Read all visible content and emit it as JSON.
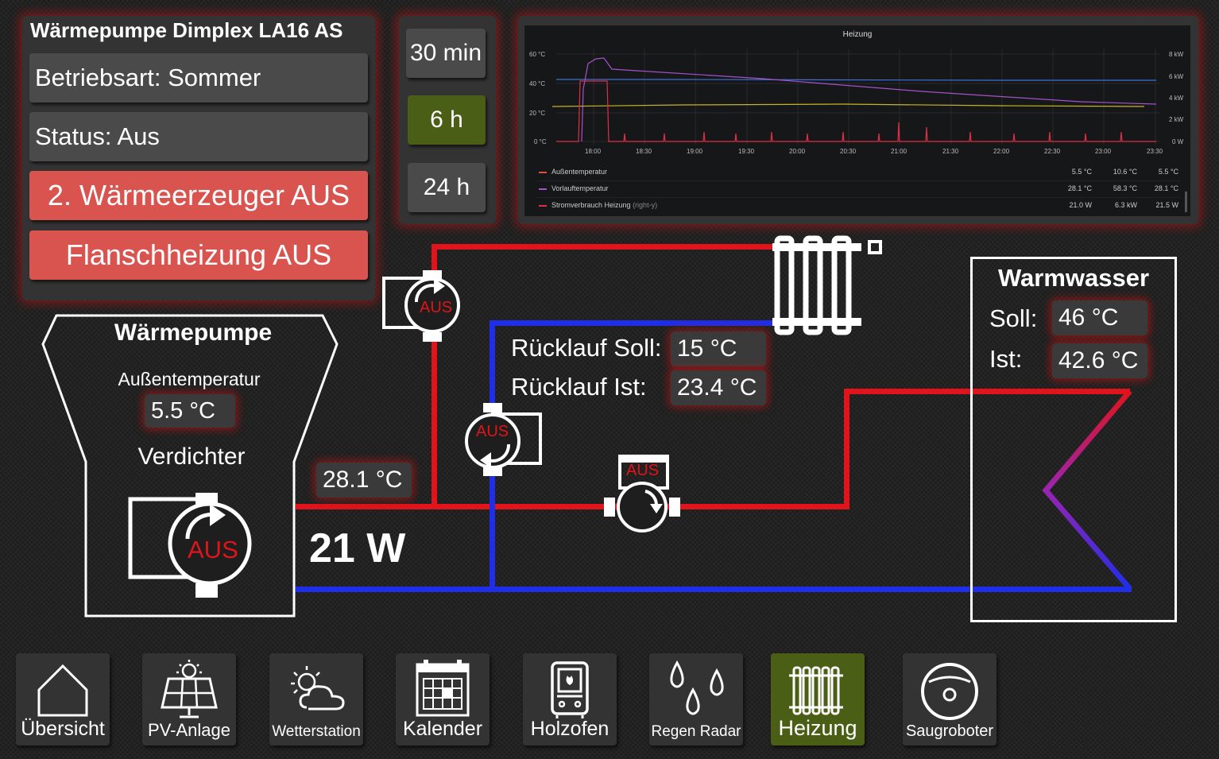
{
  "status_panel": {
    "title": "Wärmepumpe Dimplex LA16 AS",
    "mode": "Betriebsart: Sommer",
    "status": "Status: Aus",
    "second_generator": "2. Wärmeerzeuger AUS",
    "flange_heater": "Flanschheizung AUS"
  },
  "time_buttons": [
    "30 min",
    "6 h",
    "24 h"
  ],
  "graph": {
    "title": "Heizung",
    "y_left_ticks": [
      "60 °C",
      "40 °C",
      "20 °C",
      "0 °C"
    ],
    "y_right_ticks": [
      "8 kW",
      "6 kW",
      "4 kW",
      "2 kW",
      "0 W"
    ],
    "x_ticks": [
      "18:00",
      "18:30",
      "19:00",
      "19:30",
      "20:00",
      "20:30",
      "21:00",
      "21:30",
      "22:00",
      "22:30",
      "23:00",
      "23:30"
    ],
    "legend": [
      {
        "name": "Außentemperatur",
        "suffix": "",
        "color": "#e24d42",
        "v1": "5.5 °C",
        "v2": "10.6 °C",
        "v3": "5.5 °C"
      },
      {
        "name": "Vorlauftemperatur",
        "suffix": "",
        "color": "#a352cc",
        "v1": "28.1 °C",
        "v2": "58.3 °C",
        "v3": "28.1 °C"
      },
      {
        "name": "Stromverbrauch Heizung",
        "suffix": "(right-y)",
        "color": "#e02f44",
        "v1": "21.0 W",
        "v2": "6.3 kW",
        "v3": "21.5 W"
      }
    ]
  },
  "heatpump": {
    "title": "Wärmepumpe",
    "outside_label": "Außentemperatur",
    "outside_value": "5.5 °C",
    "compressor_label": "Verdichter",
    "compressor_state": "AUS"
  },
  "pumps": {
    "top_state": "AUS",
    "mid_state": "AUS",
    "valve_state": "AUS"
  },
  "flow_temp": "28.1 °C",
  "power": "21 W",
  "return": {
    "soll_label": "Rücklauf Soll:",
    "soll_value": "15 °C",
    "ist_label": "Rücklauf Ist:",
    "ist_value": "23.4 °C"
  },
  "warmwater": {
    "title": "Warmwasser",
    "soll_label": "Soll:",
    "soll_value": "46 °C",
    "ist_label": "Ist:",
    "ist_value": "42.6 °C"
  },
  "nav": [
    "Übersicht",
    "PV-Anlage",
    "Wetterstation",
    "Kalender",
    "Holzofen",
    "Regen Radar",
    "Heizung",
    "Saugroboter"
  ],
  "colors": {
    "accent_red": "#d9534f",
    "active_green": "#4b5e16",
    "pipe_red": "#e0141a",
    "pipe_blue": "#1f2ee8"
  }
}
